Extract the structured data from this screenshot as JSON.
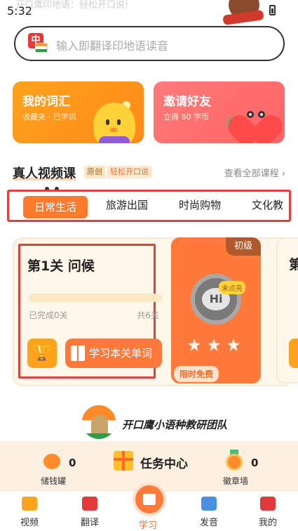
{
  "status_bar": {
    "time": "5:32",
    "ghost_text": "开口鹰印地语：轻松开口说!"
  },
  "search": {
    "placeholder": "输入即翻译印地语读音",
    "icon_glyph": "中"
  },
  "promo_cards": [
    {
      "title": "我的词汇",
      "subtitle": "收藏夹 · 已学词",
      "color": "#ffa21c"
    },
    {
      "title": "邀请好友",
      "subtitle": "立得 80 学币",
      "color": "#ff6f6f"
    }
  ],
  "section": {
    "title": "真人视频课",
    "badge_original": "原创",
    "badge_easy": "轻松开口说",
    "view_all": "查看全部课程 ›"
  },
  "tabs": {
    "active": "日常生活",
    "items": [
      "旅游出国",
      "时尚购物",
      "文化教"
    ]
  },
  "lesson": {
    "title": "第1关 问候",
    "progress": 0,
    "completed_text": "已完成0关",
    "total_text": "共6关",
    "trophy_glyph": "🏆",
    "study_button": "学习本关单词"
  },
  "level_card": {
    "level": "初级",
    "badge_text": "Hi",
    "locked_text": "未点亮",
    "stars": 3,
    "free_tag": "限时免费"
  },
  "next_card": {
    "title_peek": "第"
  },
  "team": {
    "name": "开口鹰小语种教研团队"
  },
  "taskbar": {
    "piggy_count": "0",
    "piggy_label": "储钱罐",
    "center_title": "任务中心",
    "medal_count": "0",
    "medal_label": "徽章墙"
  },
  "bottom_nav": [
    {
      "label": "视频",
      "icon": "video-icon",
      "color": "#ffa21c"
    },
    {
      "label": "翻译",
      "icon": "translate-icon",
      "color": "#e23a3a"
    },
    {
      "label": "学习",
      "icon": "book-icon",
      "color": "#ff7a3a"
    },
    {
      "label": "发音",
      "icon": "pronounce-icon",
      "color": "#4a90e2"
    },
    {
      "label": "我的",
      "icon": "profile-icon",
      "color": "#e23a3a"
    }
  ],
  "colors": {
    "accent": "#ff7a3a",
    "highlight_border": "#e2413a"
  }
}
